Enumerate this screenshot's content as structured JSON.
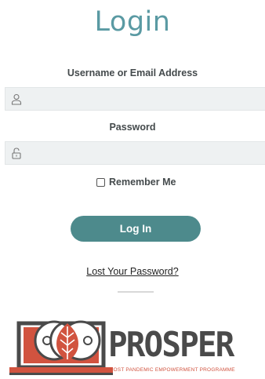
{
  "page": {
    "title": "Login"
  },
  "form": {
    "username_label": "Username or Email Address",
    "username_value": "",
    "password_label": "Password",
    "password_value": "",
    "remember_label": "Remember Me",
    "remember_checked": false,
    "submit_label": "Log In"
  },
  "links": {
    "lost_password": "Lost Your Password?"
  },
  "logo": {
    "brand": "PROSPER",
    "tagline": "POST PANDEMIC EMPOWERMENT PROGRAMME",
    "icon": "laptop-leaf-logo"
  },
  "colors": {
    "title": "#5a9aa3",
    "button": "#4d8a8c",
    "brand_red": "#d1533f",
    "brand_gray": "#4a4a4a"
  }
}
